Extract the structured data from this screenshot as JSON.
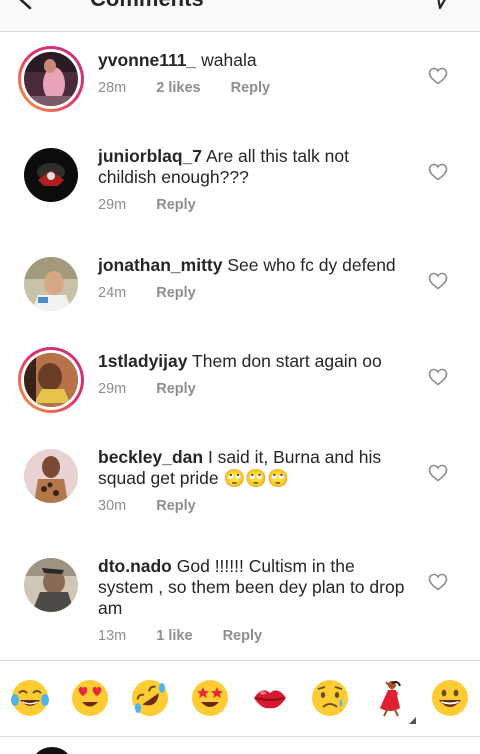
{
  "header": {
    "title": "Comments"
  },
  "comments": [
    {
      "username": "yvonne111_",
      "text": "wahala",
      "time": "28m",
      "likes": "2 likes",
      "reply": "Reply"
    },
    {
      "username": "juniorblaq_7",
      "text": "Are all this talk not childish enough???",
      "time": "29m",
      "likes": "",
      "reply": "Reply"
    },
    {
      "username": "jonathan_mitty",
      "text": "See who fc dy defend",
      "time": "24m",
      "likes": "",
      "reply": "Reply"
    },
    {
      "username": "1stladyijay",
      "text": "Them don start again oo",
      "time": "29m",
      "likes": "",
      "reply": "Reply"
    },
    {
      "username": "beckley_dan",
      "text": "I said it, Burna and his squad get pride 🙄🙄🙄",
      "time": "30m",
      "likes": "",
      "reply": "Reply"
    },
    {
      "username": "dto.nado",
      "text": "God !!!!!! Cultism in the system , so them been dey plan to drop am",
      "time": "13m",
      "likes": "1 like",
      "reply": "Reply"
    }
  ],
  "emoji_bar": {
    "emojis": [
      "😂",
      "😍",
      "🤣",
      "🤩",
      "💋",
      "😥",
      "💃",
      "😀"
    ]
  },
  "icons": {
    "back": "back-arrow-icon",
    "send": "direct-send-icon",
    "like": "heart-outline-icon"
  }
}
